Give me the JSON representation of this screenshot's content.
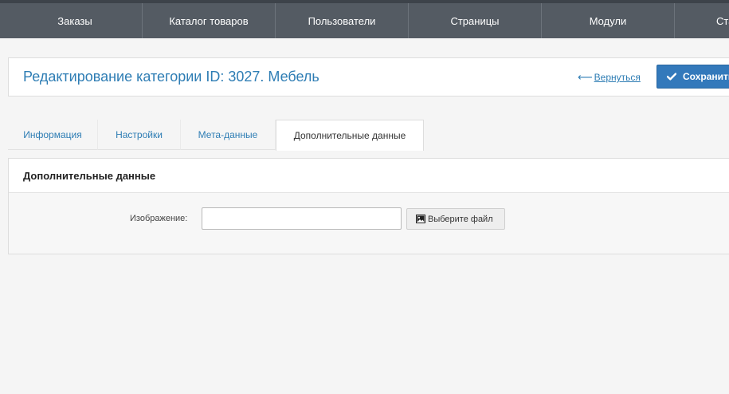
{
  "topnav": {
    "items": [
      {
        "label": "Заказы"
      },
      {
        "label": "Каталог товаров"
      },
      {
        "label": "Пользователи"
      },
      {
        "label": "Страницы"
      },
      {
        "label": "Модули"
      },
      {
        "label": "Ста"
      }
    ]
  },
  "header": {
    "title": "Редактирование категории ID: 3027. Мебель",
    "back_arrow": "⟵",
    "back_label": "Вернуться",
    "save_label": "Сохранить",
    "save_icon": "checkmark-icon"
  },
  "tabs": [
    {
      "label": "Информация",
      "active": false
    },
    {
      "label": "Настройки",
      "active": false
    },
    {
      "label": "Мета-данные",
      "active": false
    },
    {
      "label": "Дополнительные данные",
      "active": true
    }
  ],
  "section": {
    "title": "Дополнительные данные",
    "image_field": {
      "label": "Изображение:",
      "value": "",
      "button_label": "Выберите файл",
      "button_icon": "image-icon"
    }
  },
  "colors": {
    "nav_bg": "#545b63",
    "accent": "#2e7db4",
    "save_button": "#3379bb"
  }
}
